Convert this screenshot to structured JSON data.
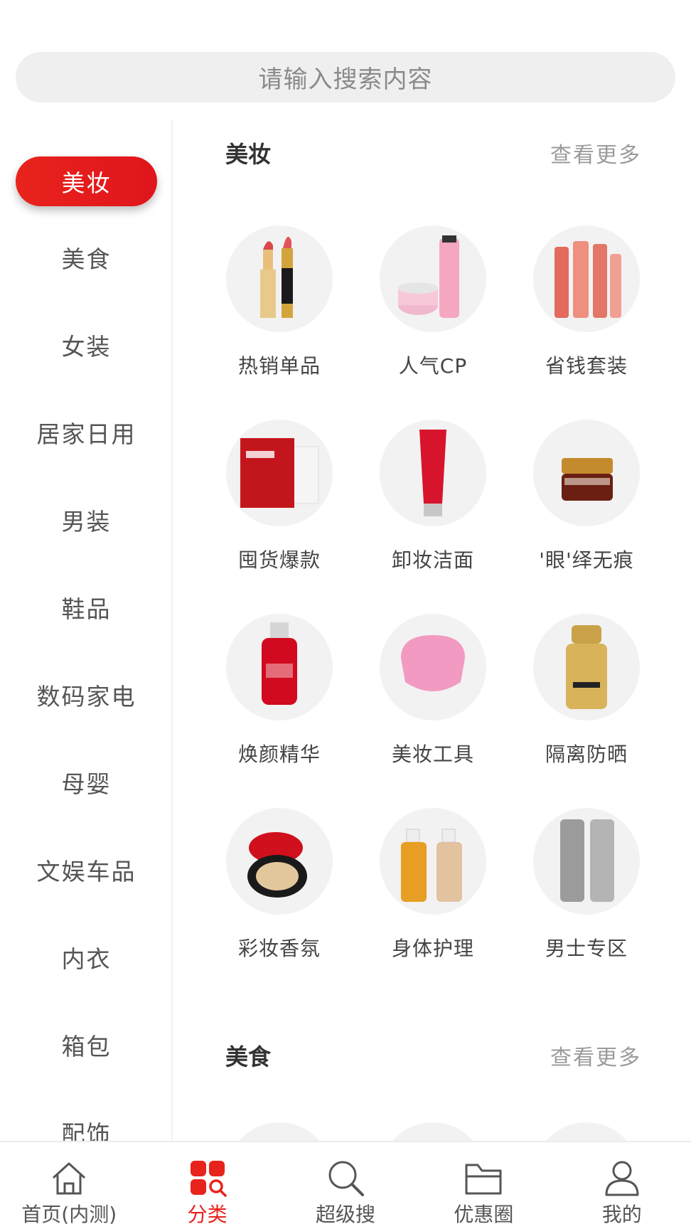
{
  "search": {
    "placeholder": "请输入搜索内容"
  },
  "sidebar": {
    "items": [
      {
        "label": "美妆",
        "active": true
      },
      {
        "label": "美食"
      },
      {
        "label": "女装"
      },
      {
        "label": "居家日用"
      },
      {
        "label": "男装"
      },
      {
        "label": "鞋品"
      },
      {
        "label": "数码家电"
      },
      {
        "label": "母婴"
      },
      {
        "label": "文娱车品"
      },
      {
        "label": "内衣"
      },
      {
        "label": "箱包"
      },
      {
        "label": "配饰"
      }
    ]
  },
  "sections": [
    {
      "title": "美妆",
      "more": "查看更多",
      "items": [
        {
          "label": "热销单品",
          "icon": "lipstick-icon"
        },
        {
          "label": "人气CP",
          "icon": "skincare-set-icon"
        },
        {
          "label": "省钱套装",
          "icon": "bottle-set-icon"
        },
        {
          "label": "囤货爆款",
          "icon": "face-mask-icon"
        },
        {
          "label": "卸妆洁面",
          "icon": "cleanser-tube-icon"
        },
        {
          "label": "'眼'绎无痕",
          "icon": "eye-cream-jar-icon"
        },
        {
          "label": "焕颜精华",
          "icon": "serum-bottle-icon"
        },
        {
          "label": "美妆工具",
          "icon": "cleansing-brush-icon"
        },
        {
          "label": "隔离防晒",
          "icon": "sunscreen-bottle-icon"
        },
        {
          "label": "彩妆香氛",
          "icon": "cushion-compact-icon"
        },
        {
          "label": "身体护理",
          "icon": "body-care-bottles-icon"
        },
        {
          "label": "男士专区",
          "icon": "men-skincare-icon"
        }
      ]
    },
    {
      "title": "美食",
      "more": "查看更多"
    }
  ],
  "tabbar": {
    "tabs": [
      {
        "label": "首页(内测)",
        "icon": "home-icon"
      },
      {
        "label": "分类",
        "icon": "category-icon",
        "active": true
      },
      {
        "label": "超级搜",
        "icon": "search-icon"
      },
      {
        "label": "优惠圈",
        "icon": "folder-icon"
      },
      {
        "label": "我的",
        "icon": "user-icon"
      }
    ]
  },
  "colors": {
    "accent": "#e8231c",
    "searchBg": "#efefef",
    "circleBg": "#f2f2f2"
  }
}
